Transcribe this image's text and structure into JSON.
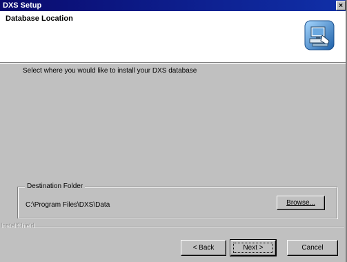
{
  "window": {
    "title": "DXS Setup",
    "close_glyph": "×"
  },
  "header": {
    "heading": "Database Location",
    "logo_icon": "computer-install-icon"
  },
  "body": {
    "instruction": "Select where you would like to install your DXS database"
  },
  "destination": {
    "legend": "Destination Folder",
    "path": "C:\\Program Files\\DXS\\Data",
    "browse_label": "Browse..."
  },
  "footer": {
    "brand": "InstallShield",
    "back_label": "< Back",
    "next_label": "Next >",
    "cancel_label": "Cancel"
  },
  "colors": {
    "titlebar": "#0a0a6e",
    "dialog_face": "#c0c0c0",
    "header_bg": "#ffffff"
  }
}
